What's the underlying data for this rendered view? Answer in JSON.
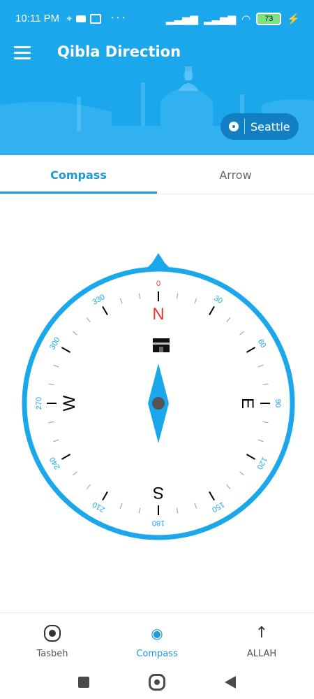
{
  "status_bar": {
    "time": "10:11 PM",
    "dots": "···",
    "battery": "73"
  },
  "header": {
    "title": "Qibla Direction",
    "location": "Seattle"
  },
  "tabs": [
    {
      "label": "Compass",
      "active": true
    },
    {
      "label": "Arrow",
      "active": false
    }
  ],
  "compass": {
    "cardinals": [
      "N",
      "E",
      "S",
      "W"
    ],
    "degree_labels": [
      "0",
      "30",
      "60",
      "90",
      "120",
      "150",
      "180",
      "210",
      "240",
      "270",
      "300",
      "330"
    ],
    "colors": {
      "ring": "#1aa7ec",
      "accent": "#1aa7ec",
      "north_red": "#e53935",
      "tick": "#000000"
    }
  },
  "bottom_nav": [
    {
      "label": "Tasbeh",
      "icon": "radio-button-icon",
      "active": false
    },
    {
      "label": "Compass",
      "icon": "wifi-icon",
      "active": true
    },
    {
      "label": "ALLAH",
      "icon": "arrow-up-icon",
      "active": false
    }
  ],
  "system_nav": {
    "buttons": [
      "recent-apps",
      "home",
      "back"
    ]
  }
}
